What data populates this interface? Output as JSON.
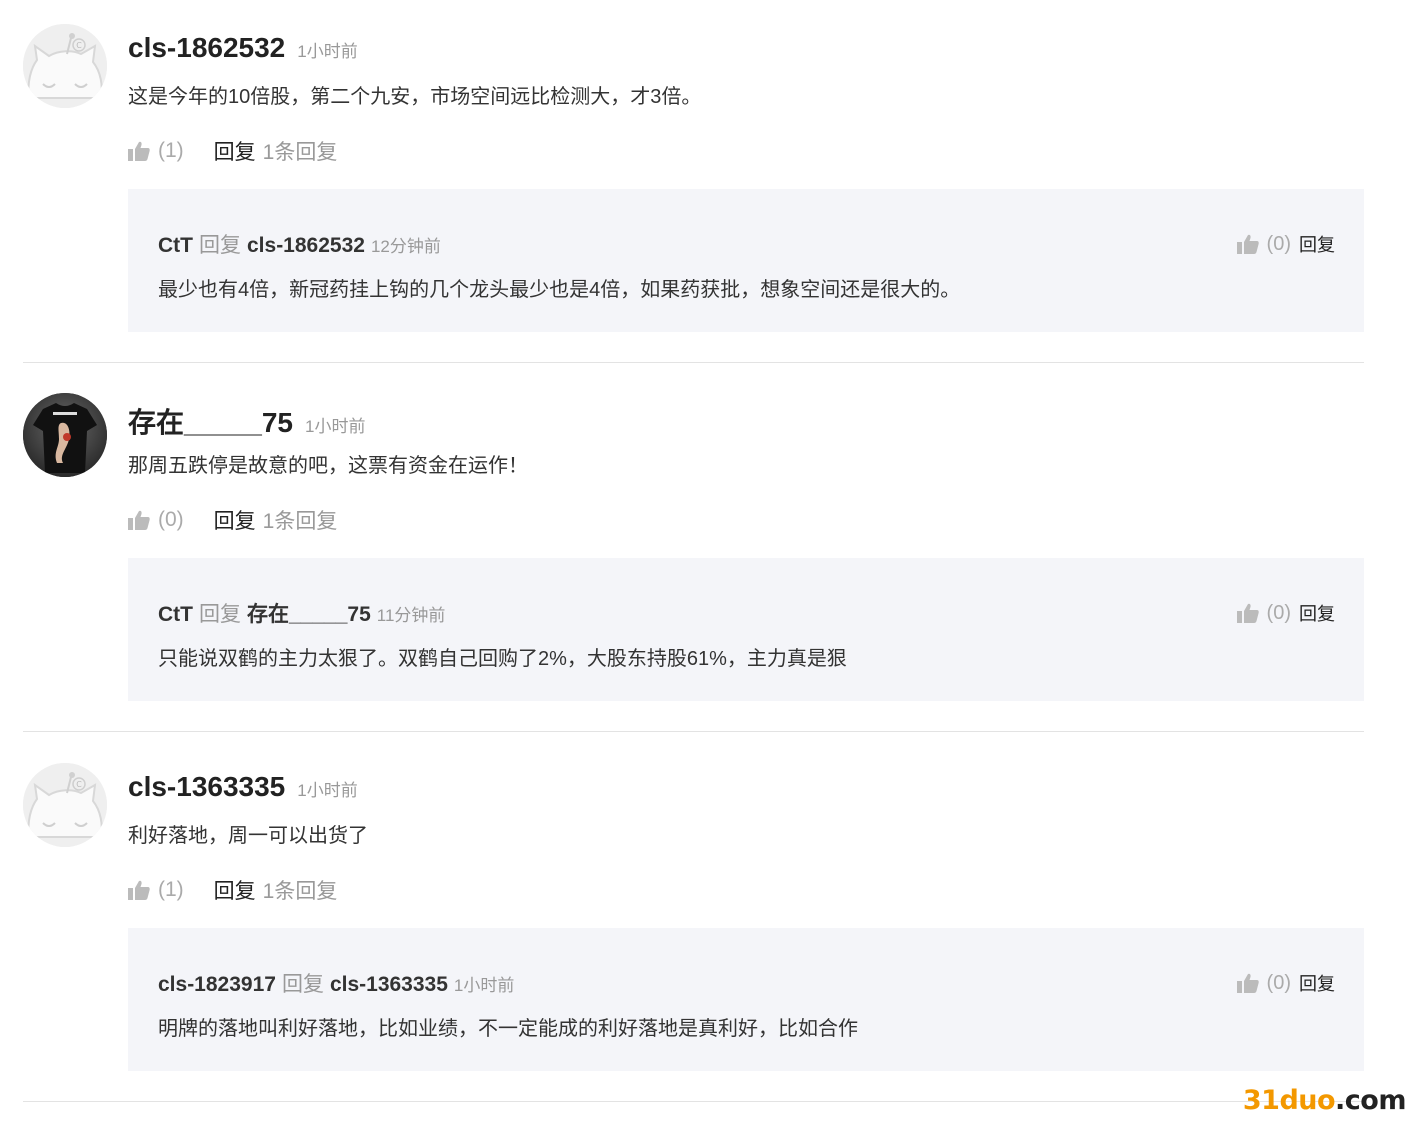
{
  "comments": [
    {
      "username": "cls-1862532",
      "time": "1小时前",
      "content": "这是今年的10倍股，第二个九安，市场空间远比检测大，才3倍。",
      "likes": "(1)",
      "reply_label": "回复",
      "reply_count": "1条回复",
      "avatar": "default-cat-icon",
      "reply": {
        "user": "CtT",
        "word": "回复",
        "target": "cls-1862532",
        "time": "12分钟前",
        "content": "最少也有4倍，新冠药挂上钩的几个龙头最少也是4倍，如果药获批，想象空间还是很大的。",
        "likes": "(0)",
        "reply_label": "回复"
      }
    },
    {
      "username": "存在_____75",
      "time": "1小时前",
      "content": "那周五跌停是故意的吧，这票有资金在运作！",
      "likes": "(0)",
      "reply_label": "回复",
      "reply_count": "1条回复",
      "avatar": "photo-tshirt",
      "reply": {
        "user": "CtT",
        "word": "回复",
        "target": "存在_____75",
        "time": "11分钟前",
        "content": "只能说双鹤的主力太狠了。双鹤自己回购了2%，大股东持股61%，主力真是狠",
        "likes": "(0)",
        "reply_label": "回复"
      }
    },
    {
      "username": "cls-1363335",
      "time": "1小时前",
      "content": "利好落地，周一可以出货了",
      "likes": "(1)",
      "reply_label": "回复",
      "reply_count": "1条回复",
      "avatar": "default-cat-icon",
      "reply": {
        "user": "cls-1823917",
        "word": "回复",
        "target": "cls-1363335",
        "time": "1小时前",
        "content": "明牌的落地叫利好落地，比如业绩，不一定能成的利好落地是真利好，比如合作",
        "likes": "(0)",
        "reply_label": "回复"
      }
    }
  ],
  "watermark": {
    "part1": "31duo",
    "part2": ".com"
  },
  "colors": {
    "meta": "#999999",
    "reply_bg": "#f4f5f9",
    "divider": "#e3e3e3",
    "watermark": "#f39800"
  }
}
